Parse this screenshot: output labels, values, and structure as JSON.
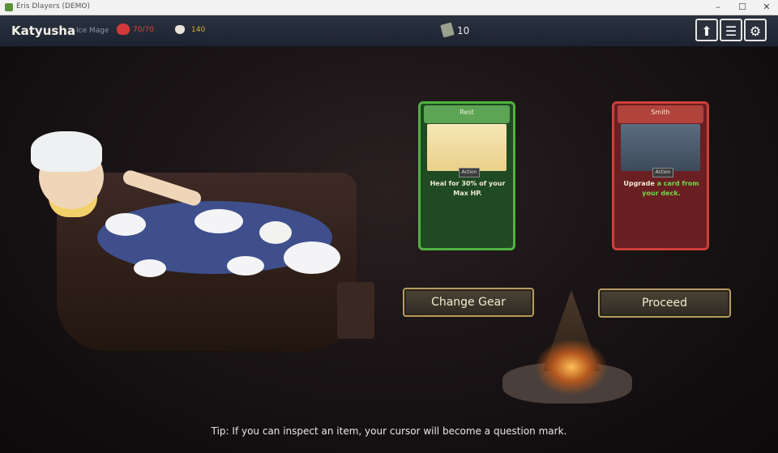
{
  "window": {
    "title": "Eris Dlayers (DEMO)",
    "minimize": "–",
    "maximize": "☐",
    "close": "✕"
  },
  "hud": {
    "hero_name": "Katyusha",
    "hero_class": "Ice Mage",
    "hp": "70/70",
    "gold": "140",
    "deck_count": "10",
    "icons": [
      "heart-icon",
      "gold-pouch-icon",
      "deck-icon",
      "upload-icon",
      "menu-icon",
      "settings-icon"
    ],
    "upload_glyph": "⬆",
    "menu_glyph": "☰",
    "settings_glyph": "⚙"
  },
  "cards": {
    "rest": {
      "title": "Rest",
      "type": "Action",
      "desc": "Heal for 30% of your Max HP."
    },
    "smith": {
      "title": "Smith",
      "type": "Action",
      "desc_pre": "Upgrade",
      "desc_hl": "a card from your deck."
    }
  },
  "buttons": {
    "change_gear": "Change Gear",
    "proceed": "Proceed"
  },
  "tip": "Tip: If you can inspect an item, your cursor will become a question mark.",
  "colors": {
    "rest_card": "#4fb33f",
    "smith_card": "#cf3f3b",
    "gold_text": "#d9a93a",
    "hp_text": "#d44a3c",
    "highlight": "#6fdc4d"
  }
}
